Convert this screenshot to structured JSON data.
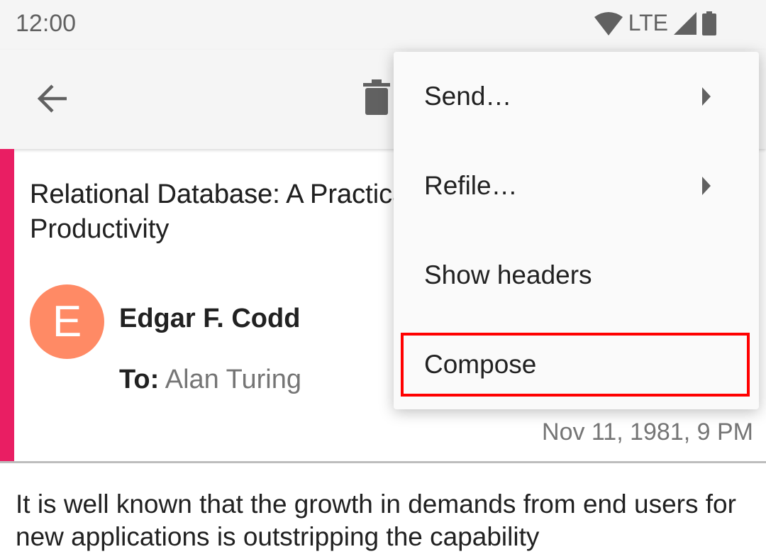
{
  "status_bar": {
    "time": "12:00",
    "network": "LTE"
  },
  "email": {
    "subject": "Relational Database: A Practical Foundation for Productivity",
    "subject_line1": "Relational Database: A Prac",
    "subject_line2": "Productivity",
    "avatar_letter": "E",
    "sender": "Edgar F. Codd",
    "to_label": "To:",
    "to_value": "Alan Turing",
    "date": "Nov 11, 1981, 9 PM",
    "body": "It is well known that the growth in demands from end users for new applications is outstripping the capability"
  },
  "menu": {
    "items": [
      {
        "label": "Send…"
      },
      {
        "label": "Refile…"
      },
      {
        "label": "Show headers"
      },
      {
        "label": "Compose"
      }
    ]
  },
  "colors": {
    "accent": "#e91e63",
    "avatar": "#ff8a65",
    "highlight": "#ff0000"
  }
}
